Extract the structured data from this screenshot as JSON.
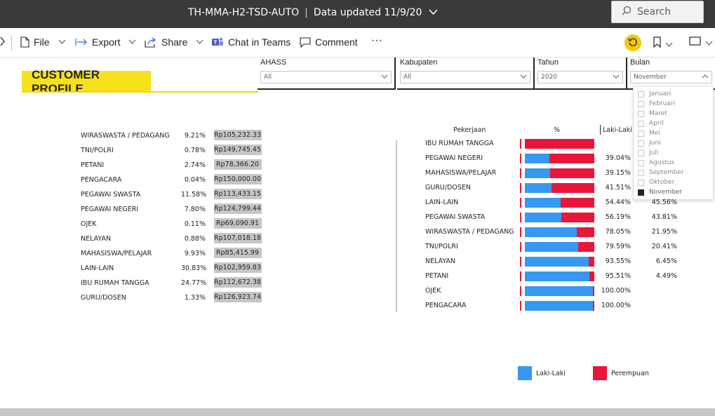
{
  "titlebar": {
    "report_title": "TH-MMA-H2-TSD-AUTO",
    "separator": "|",
    "data_updated": "Data updated 11/9/20",
    "search_placeholder": "Search"
  },
  "toolbar": {
    "file_label": "File",
    "export_label": "Export",
    "share_label": "Share",
    "chat_label": "Chat in Teams",
    "comment_label": "Comment",
    "more_label": "···"
  },
  "colors": {
    "banner": "#f7e11a",
    "laki_laki": "#3599f2",
    "perempuan": "#e8163b",
    "amount_cell": "#c8c6c4"
  },
  "report": {
    "header_title": "CUSTOMER PROFILE"
  },
  "slicers": {
    "ahass": {
      "label": "AHASS",
      "value": "All"
    },
    "kabupaten": {
      "label": "Kabupaten",
      "value": "All"
    },
    "tahun": {
      "label": "Tahun",
      "value": "2020"
    },
    "bulan": {
      "label": "Bulan",
      "value": "November"
    }
  },
  "bulan_options": [
    {
      "label": "Januari",
      "checked": false
    },
    {
      "label": "Februari",
      "checked": false
    },
    {
      "label": "Maret",
      "checked": false
    },
    {
      "label": "April",
      "checked": false
    },
    {
      "label": "Mei",
      "checked": false
    },
    {
      "label": "Juni",
      "checked": false
    },
    {
      "label": "Juli",
      "checked": false
    },
    {
      "label": "Agustus",
      "checked": false
    },
    {
      "label": "September",
      "checked": false
    },
    {
      "label": "Oktober",
      "checked": false
    },
    {
      "label": "November",
      "checked": true
    }
  ],
  "occupation_table": [
    {
      "name": "WIRASWASTA / PEDAGANG",
      "pct": "9.21%",
      "amount": "Rp105,232.33"
    },
    {
      "name": "TNI/POLRI",
      "pct": "0.78%",
      "amount": "Rp149,745.45"
    },
    {
      "name": "PETANI",
      "pct": "2.74%",
      "amount": "Rp78,366.20"
    },
    {
      "name": "PENGACARA",
      "pct": "0.04%",
      "amount": "Rp150,000.00"
    },
    {
      "name": "PEGAWAI SWASTA",
      "pct": "11.58%",
      "amount": "Rp113,433.15"
    },
    {
      "name": "PEGAWAI NEGERI",
      "pct": "7.80%",
      "amount": "Rp124,799.44"
    },
    {
      "name": "OJEK",
      "pct": "0.11%",
      "amount": "Rp69,090.91"
    },
    {
      "name": "NELAYAN",
      "pct": "0.88%",
      "amount": "Rp107,018.18"
    },
    {
      "name": "MAHASISWA/PELAJAR",
      "pct": "9.93%",
      "amount": "Rp85,415.99"
    },
    {
      "name": "LAIN-LAIN",
      "pct": "30.83%",
      "amount": "Rp102,959.83"
    },
    {
      "name": "IBU RUMAH TANGGA",
      "pct": "24.77%",
      "amount": "Rp112,672.38"
    },
    {
      "name": "GURU/DOSEN",
      "pct": "1.33%",
      "amount": "Rp126,923.74"
    }
  ],
  "gender_chart": {
    "headers": {
      "pekerjaan": "Pekerjaan",
      "pct": "%",
      "laki": "Laki-Laki"
    },
    "legend": {
      "laki": "Laki-Laki",
      "perempuan": "Perempuan"
    }
  },
  "chart_data": {
    "type": "bar",
    "stacked": "100%",
    "categories": [
      "IBU RUMAH TANGGA",
      "PEGAWAI NEGERI",
      "MAHASISWA/PELAJAR",
      "GURU/DOSEN",
      "LAIN-LAIN",
      "PEGAWAI SWASTA",
      "WIRASWASTA / PEDAGANG",
      "TNI/POLRI",
      "NELAYAN",
      "PETANI",
      "OJEK",
      "PENGACARA"
    ],
    "series": [
      {
        "name": "Laki-Laki",
        "values": [
          0,
          35.4,
          36.2,
          38.5,
          51.4,
          52.2,
          74.5,
          77.0,
          91.5,
          93.0,
          97.5,
          97.5
        ]
      },
      {
        "name": "Perempuan",
        "values": [
          100,
          64.6,
          63.8,
          61.5,
          48.6,
          47.8,
          25.5,
          23.0,
          8.5,
          7.0,
          2.5,
          2.5
        ]
      }
    ],
    "laki_labels": [
      "",
      "39.04%",
      "39.15%",
      "41.51%",
      "54.44%",
      "56.19%",
      "78.05%",
      "79.59%",
      "93.55%",
      "95.51%",
      "100.00%",
      "100.00%"
    ],
    "perempuan_labels": [
      "",
      "",
      "",
      "",
      "45.56%",
      "43.81%",
      "21.95%",
      "20.41%",
      "6.45%",
      "4.49%",
      "",
      ""
    ]
  }
}
